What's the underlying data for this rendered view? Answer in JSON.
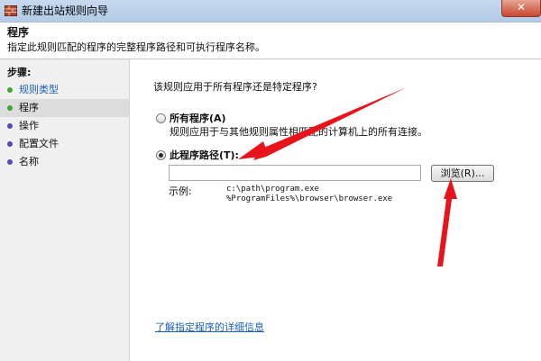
{
  "window": {
    "title": "新建出站规则向导",
    "close_label": "✕"
  },
  "header": {
    "title": "程序",
    "description": "指定此规则匹配的程序的完整程序路径和可执行程序名称。"
  },
  "steps": {
    "title": "步骤:",
    "items": [
      {
        "label": "规则类型",
        "state": "done"
      },
      {
        "label": "程序",
        "state": "current"
      },
      {
        "label": "操作",
        "state": "pending"
      },
      {
        "label": "配置文件",
        "state": "pending"
      },
      {
        "label": "名称",
        "state": "pending"
      }
    ]
  },
  "content": {
    "question": "该规则应用于所有程序还是特定程序?",
    "option_all": {
      "label": "所有程序(A)",
      "description": "规则应用于与其他规则属性相匹配的计算机上的所有连接。",
      "selected": false
    },
    "option_path": {
      "label": "此程序路径(T):",
      "selected": true
    },
    "path_value": "",
    "browse_label": "浏览(R)...",
    "example_label": "示例:",
    "example_lines": [
      "c:\\path\\program.exe",
      "%ProgramFiles%\\browser\\browser.exe"
    ],
    "help_link": "了解指定程序的详细信息"
  },
  "colors": {
    "step_done": "#3ea634",
    "step_current": "#3ea634",
    "step_pending": "#4f4ab8",
    "link": "#1b5fbd",
    "annotation_arrow": "#e8141c"
  }
}
